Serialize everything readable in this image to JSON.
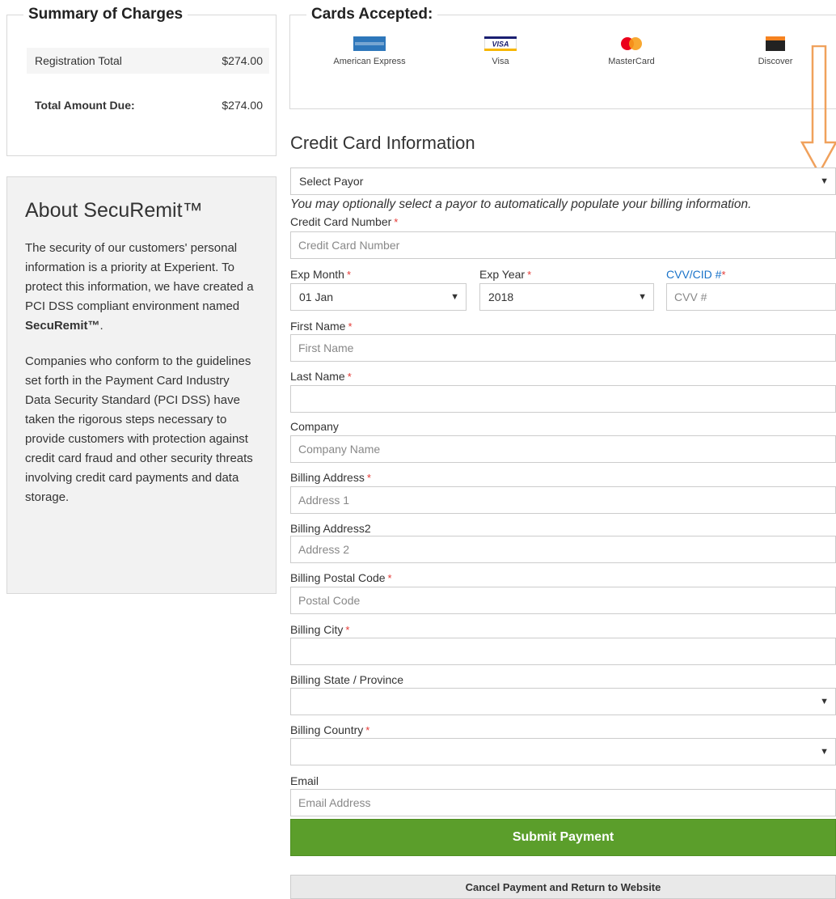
{
  "summary": {
    "title": "Summary of Charges",
    "rows": [
      {
        "label": "Registration Total",
        "value": "$274.00"
      },
      {
        "label": "Total Amount Due:",
        "value": "$274.00"
      }
    ]
  },
  "cards": {
    "title": "Cards Accepted:",
    "items": [
      {
        "name": "American Express",
        "logo_text": "AMERICAN EXPRESS",
        "color": "#2e77bb"
      },
      {
        "name": "Visa",
        "logo_text": "VISA",
        "color": "#1a1f71"
      },
      {
        "name": "MasterCard",
        "logo_text": "MasterCard",
        "color": "#eb001b"
      },
      {
        "name": "Discover",
        "logo_text": "DISCOVER",
        "color": "#f58220"
      }
    ]
  },
  "about": {
    "title": "About SecuRemit™",
    "p1_text": "The security of our customers' personal information is a priority at Experient. To protect this information, we have created a PCI DSS compliant environment named ",
    "p1_bold": "SecuRemit™",
    "p1_end": ".",
    "p2": "Companies who conform to the guidelines set forth in the Payment Card Industry Data Security Standard (PCI DSS) have taken the rigorous steps necessary to provide customers with protection against credit card fraud and other security threats involving credit card payments and data storage."
  },
  "form": {
    "title": "Credit Card Information",
    "payor": {
      "value": "Select Payor",
      "hint": "You may optionally select a payor to automatically populate your billing information."
    },
    "card_number": {
      "label": "Credit Card Number",
      "placeholder": "Credit Card Number"
    },
    "exp_month": {
      "label": "Exp Month",
      "value": "01 Jan"
    },
    "exp_year": {
      "label": "Exp Year",
      "value": "2018"
    },
    "cvv": {
      "label": "CVV/CID #",
      "placeholder": "CVV #"
    },
    "first_name": {
      "label": "First Name",
      "placeholder": "First Name"
    },
    "last_name": {
      "label": "Last Name",
      "placeholder": ""
    },
    "company": {
      "label": "Company",
      "placeholder": "Company Name"
    },
    "address1": {
      "label": "Billing Address",
      "placeholder": "Address 1"
    },
    "address2": {
      "label": "Billing Address2",
      "placeholder": "Address 2"
    },
    "postal": {
      "label": "Billing Postal Code",
      "placeholder": "Postal Code"
    },
    "city": {
      "label": "Billing City",
      "placeholder": ""
    },
    "state": {
      "label": "Billing State / Province",
      "value": ""
    },
    "country": {
      "label": "Billing Country",
      "value": ""
    },
    "email": {
      "label": "Email",
      "placeholder": "Email Address"
    },
    "required_mark": "*",
    "caret": "▼"
  },
  "buttons": {
    "submit": "Submit Payment",
    "cancel": "Cancel Payment and Return to Website"
  },
  "annotation": {
    "arrow_color": "#f0a15c"
  }
}
